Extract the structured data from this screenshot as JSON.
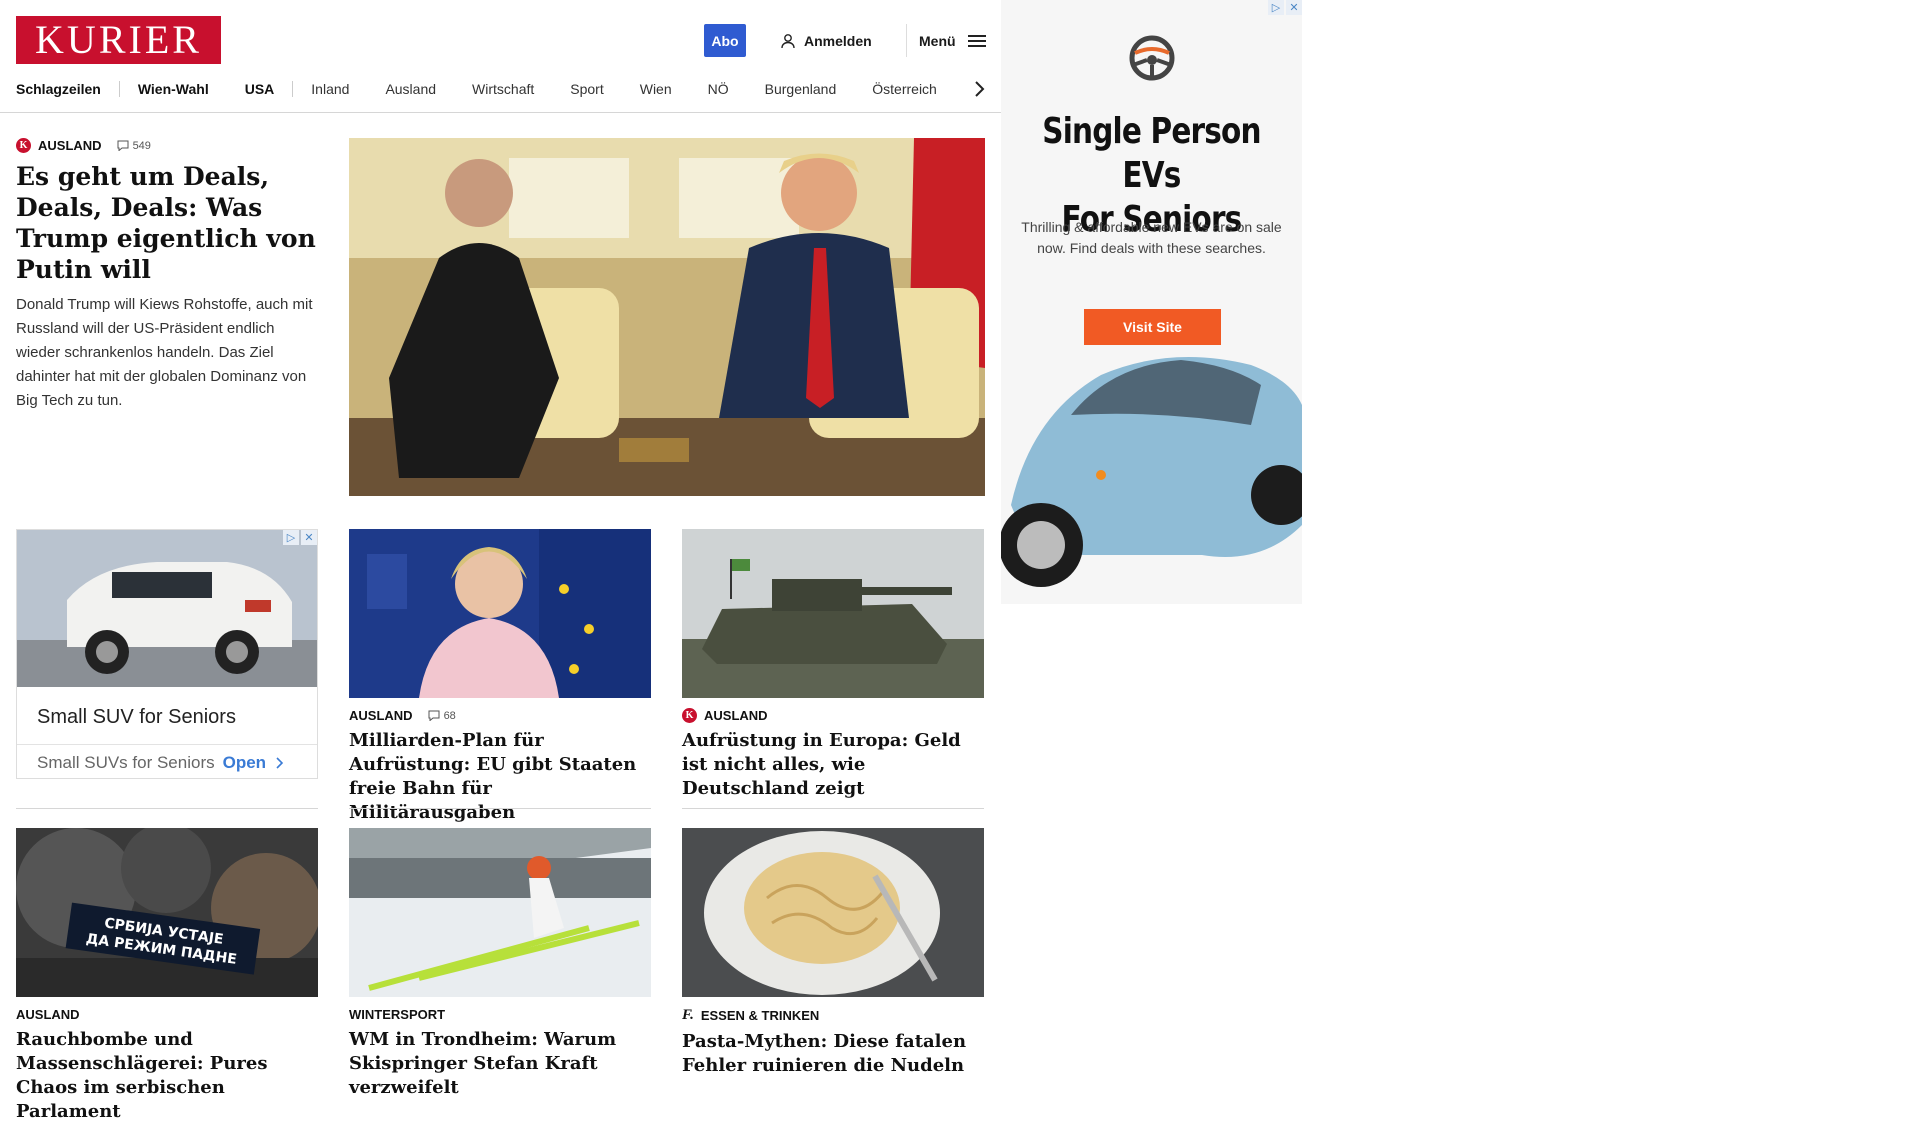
{
  "header": {
    "logo": "KURIER",
    "abo_label": "Abo",
    "login_label": "Anmelden",
    "menu_label": "Menü"
  },
  "nav": {
    "items": [
      "Schlagzeilen",
      "Wien-Wahl",
      "USA",
      "Inland",
      "Ausland",
      "Wirtschaft",
      "Sport",
      "Wien",
      "NÖ",
      "Burgenland",
      "Österreich"
    ]
  },
  "lead": {
    "kicker": "AUSLAND",
    "comments": "549",
    "title": "Es geht um Deals, Deals, Deals: Was Trump eigentlich von Putin will",
    "teaser": "Donald Trump will Kiews Rohstoffe, auch mit Russland will der US-Präsident endlich wieder schrankenlos handeln. Das Ziel dahinter hat mit der globalen Dominanz von Big Tech zu tun."
  },
  "sponsored_small": {
    "title": "Small SUV for Seniors",
    "subtitle": "Small SUVs for Seniors",
    "cta": "Open"
  },
  "cards": [
    {
      "kicker": "AUSLAND",
      "comments": "68",
      "title": "Milliarden-Plan für Aufrüstung: EU gibt Staaten freie Bahn für Militärausgaben"
    },
    {
      "kicker": "AUSLAND",
      "title": "Aufrüstung in Europa: Geld ist nicht alles, wie Deutschland zeigt"
    },
    {
      "kicker": "AUSLAND",
      "title": "Rauchbombe und Massenschlägerei: Pures Chaos im serbischen Parlament"
    },
    {
      "kicker": "WINTERSPORT",
      "title": "WM in Trondheim: Warum Skispringer Stefan Kraft verzweifelt"
    },
    {
      "kicker": "ESSEN & TRINKEN",
      "title": "Pasta-Mythen: Diese fatalen Fehler ruinieren die Nudeln"
    }
  ],
  "photo_text": {
    "banner_line1": "СРБИЈА УСТАЈЕ",
    "banner_line2": "ДА РЕЖИМ ПАДНЕ"
  },
  "ad_right": {
    "title_line1": "Single Person EVs",
    "title_line2": "For Seniors",
    "text": "Thrilling & affordable new EVs are on sale now. Find deals with these searches.",
    "button": "Visit Site"
  },
  "colors": {
    "brand_red": "#c8102e",
    "abo_blue": "#2f5bd1",
    "ad_orange": "#f15a24"
  }
}
